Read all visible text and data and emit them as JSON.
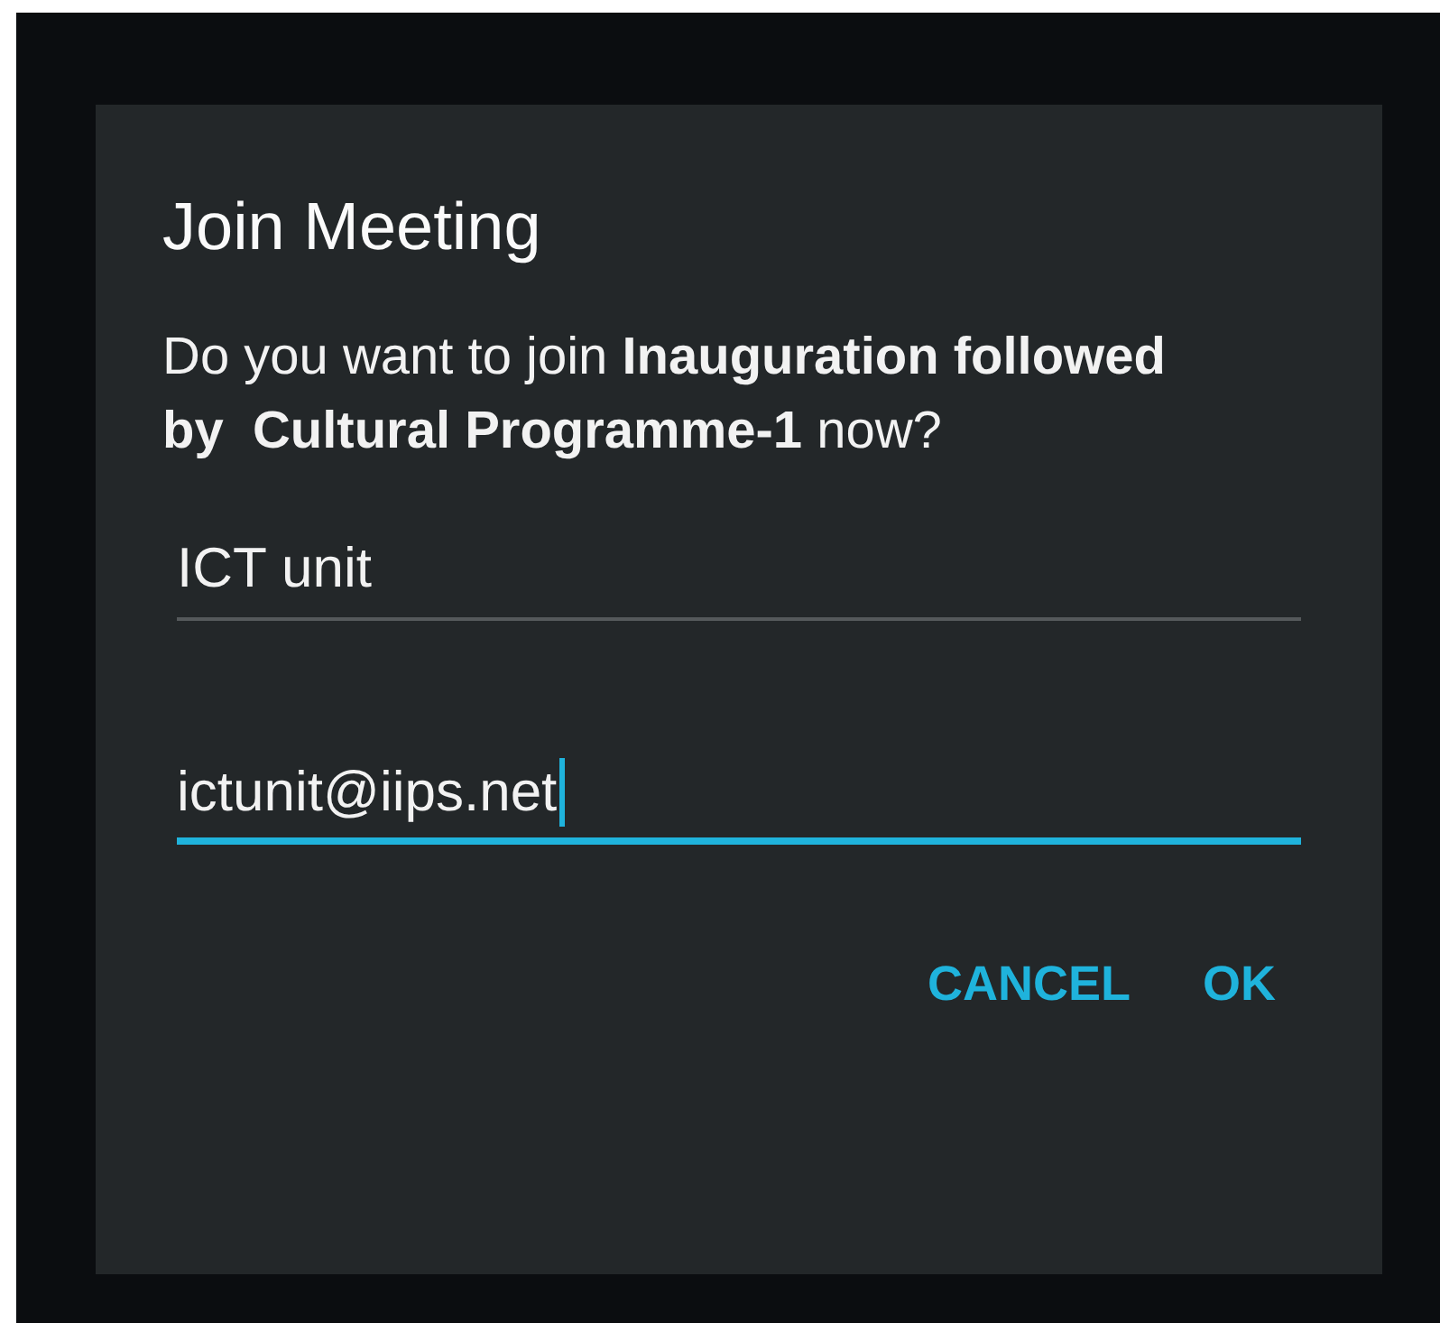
{
  "dialog": {
    "title": "Join Meeting",
    "message": "Do you want to join **Inauguration followed by  Cultural Programme-1** now?",
    "fields": [
      {
        "value": "ICT unit",
        "focused": false
      },
      {
        "value": "ictunit@iips.net",
        "focused": true
      }
    ],
    "buttons": [
      {
        "label": "CANCEL"
      },
      {
        "label": "OK"
      }
    ]
  }
}
